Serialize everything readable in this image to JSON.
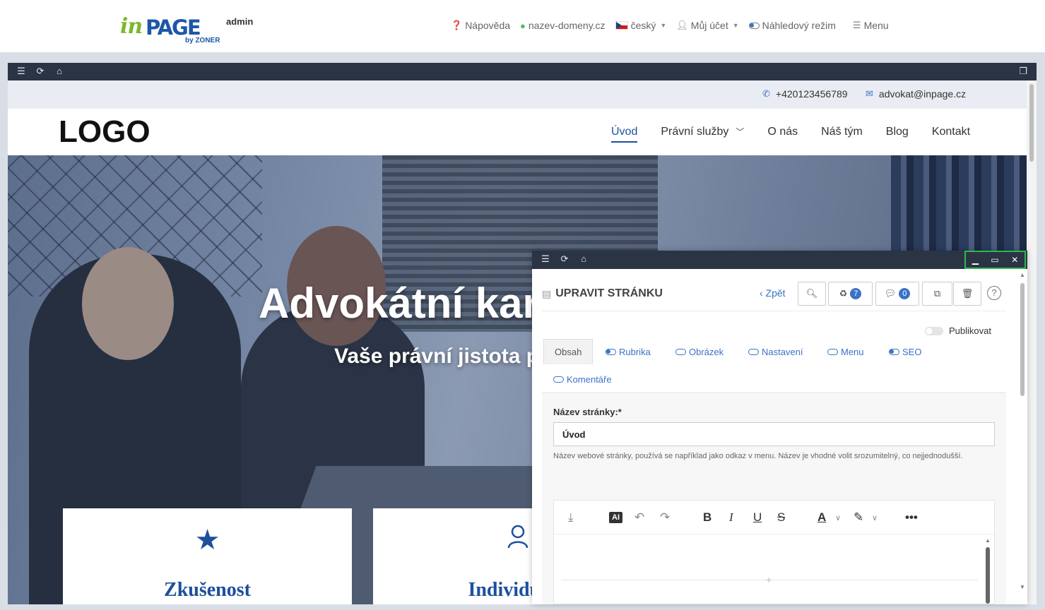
{
  "admin": {
    "logo_in": "in",
    "logo_page": "PAGE",
    "logo_admin": "admin",
    "logo_by": "by ZONER",
    "nav": {
      "help": "Nápověda",
      "domain": "nazev-domeny.cz",
      "language": "český",
      "account": "Můj účet",
      "preview_mode": "Náhledový režim",
      "menu": "Menu"
    }
  },
  "site": {
    "phone": "+420123456789",
    "email": "advokat@inpage.cz",
    "logo": "LOGO",
    "nav": [
      "Úvod",
      "Právní služby",
      "O nás",
      "Náš tým",
      "Blog",
      "Kontakt"
    ],
    "active_nav": "Úvod",
    "hero_title": "Advokátní kar",
    "hero_subtitle": "Vaše právní jistota p",
    "cards": [
      {
        "icon": "star-icon",
        "title": "Zkušenost"
      },
      {
        "icon": "user-icon",
        "title": "Individualn"
      }
    ]
  },
  "editor": {
    "title": "UPRAVIT STRÁNKU",
    "back": "‹ Zpět",
    "recycle_count": "7",
    "comments_count": "0",
    "publish_label": "Publikovat",
    "tabs": {
      "obsah": "Obsah",
      "rubrika": "Rubrika",
      "obrazek": "Obrázek",
      "nastaveni": "Nastavení",
      "menu": "Menu",
      "seo": "SEO",
      "komentare": "Komentáře"
    },
    "page_name_label": "Název stránky:*",
    "page_name_value": "Úvod",
    "page_name_hint": "Název webové stránky, používá se například jako odkaz v menu. Název je vhodné volit srozumitelný, co nejjednodušší.",
    "rte_ai": "AI"
  },
  "colors": {
    "accent": "#1d4f9c",
    "link": "#3a73c5",
    "window_bar": "#2a3444",
    "highlight": "#2eb84b"
  }
}
